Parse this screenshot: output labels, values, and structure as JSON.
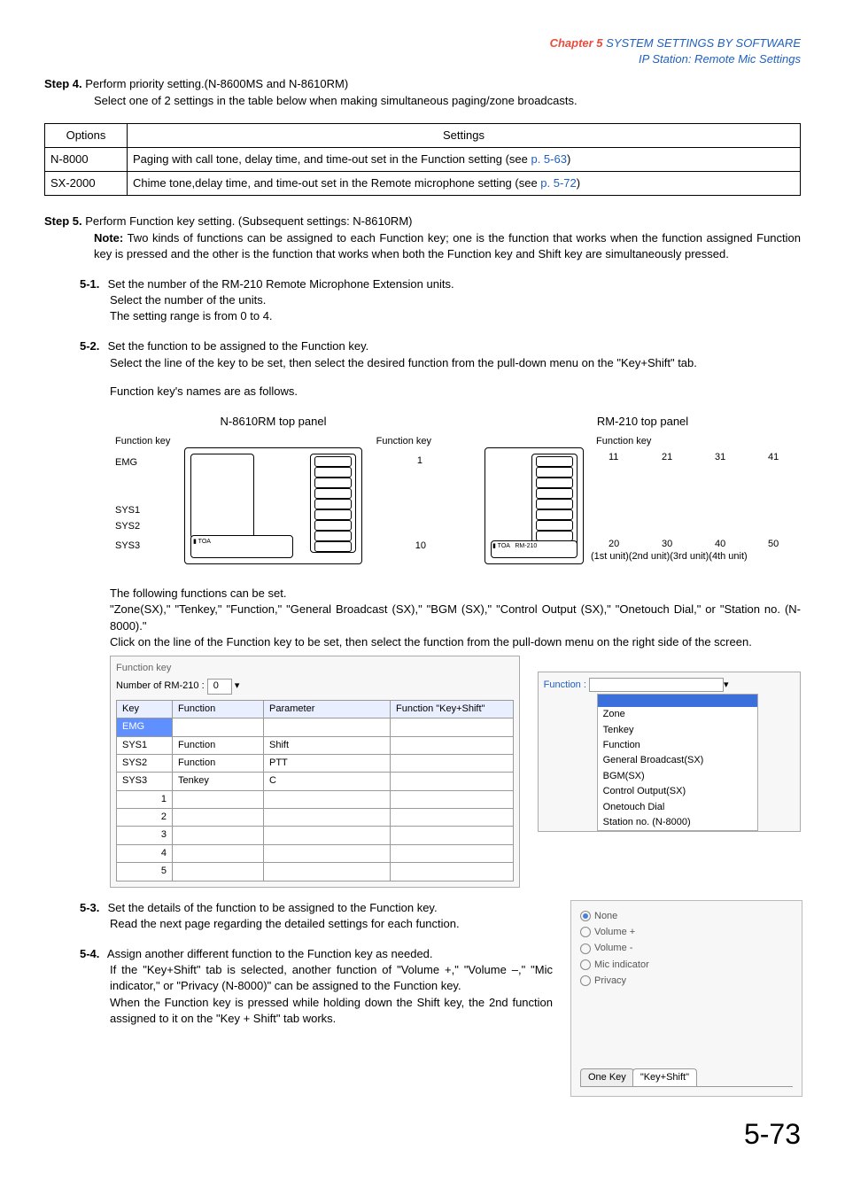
{
  "chapter": {
    "prefix": "Chapter 5",
    "title": "SYSTEM SETTINGS BY SOFTWARE",
    "subtitle": "IP Station: Remote Mic Settings"
  },
  "step4": {
    "label": "Step 4.",
    "title": "Perform priority setting.(N-8600MS and N-8610RM)",
    "desc": "Select one of 2 settings in the table below when making simultaneous paging/zone broadcasts."
  },
  "options_table": {
    "h1": "Options",
    "h2": "Settings",
    "r1c1": "N-8000",
    "r1c2a": "Paging with call tone, delay time, and time-out set in the Function setting (see ",
    "r1c2b": "p. 5-63",
    "r1c2c": ")",
    "r2c1": "SX-2000",
    "r2c2a": "Chime tone,delay time, and time-out set in the Remote microphone setting (see ",
    "r2c2b": "p. 5-72",
    "r2c2c": ")"
  },
  "step5": {
    "label": "Step 5.",
    "title": "Perform Function key setting. (Subsequent settings: N-8610RM)",
    "note_label": "Note:",
    "note_text": "Two kinds of functions can be assigned to each Function key; one is the function that works when the function assigned Function key is pressed and the other is the function that works when both the Function key and Shift key are simultaneously pressed."
  },
  "s51": {
    "label": "5-1.",
    "line1": "Set the number of the RM-210 Remote Microphone Extension units.",
    "line2": "Select the number of the units.",
    "line3": "The setting range is from 0 to 4."
  },
  "s52": {
    "label": "5-2.",
    "line1": "Set the function to be assigned to the Function key.",
    "line2": "Select the line of the key to be set, then select the desired function from the pull-down menu on the \"Key+Shift\" tab.",
    "line3": "Function key's names are as follows."
  },
  "diagrams": {
    "left_title": "N-8610RM top panel",
    "right_title": "RM-210 top panel",
    "fnkey": "Function key",
    "emg": "EMG",
    "sys1": "SYS1",
    "sys2": "SYS2",
    "sys3": "SYS3",
    "n1": "1",
    "n10": "10",
    "n11": "11",
    "n21": "21",
    "n31": "31",
    "n41": "41",
    "n20": "20",
    "n30": "30",
    "n40": "40",
    "n50": "50",
    "units": "(1st unit)(2nd unit)(3rd unit)(4th unit)"
  },
  "after_diag": {
    "line1": "The following functions can be set.",
    "line2": "\"Zone(SX),\" \"Tenkey,\" \"Function,\" \"General Broadcast (SX),\" \"BGM (SX),\" \"Control Output (SX),\" \"Onetouch Dial,\" or \"Station no. (N-8000).\"",
    "line3": "Click on the line of the Function key to be set, then select the function from the pull-down menu on the right side of the screen."
  },
  "fk_panel": {
    "group": "Function key",
    "rm_label": "Number of RM-210 :",
    "rm_val": "0",
    "h_key": "Key",
    "h_fn": "Function",
    "h_param": "Parameter",
    "h_ks": "Function \"Key+Shift\"",
    "rows": {
      "emg": "EMG",
      "sys1": "SYS1",
      "sys1_fn": "Function",
      "sys1_p": "Shift",
      "sys2": "SYS2",
      "sys2_fn": "Function",
      "sys2_p": "PTT",
      "sys3": "SYS3",
      "sys3_fn": "Tenkey",
      "sys3_p": "C",
      "r1": "1",
      "r2": "2",
      "r3": "3",
      "r4": "4",
      "r5": "5"
    },
    "dd_label": "Function :",
    "dd_items": {
      "zone": "Zone",
      "tenkey": "Tenkey",
      "function": "Function",
      "gb": "General Broadcast(SX)",
      "bgm": "BGM(SX)",
      "co": "Control Output(SX)",
      "od": "Onetouch Dial",
      "sn": "Station no. (N-8000)"
    }
  },
  "s53": {
    "label": "5-3.",
    "line1": "Set the details of the function to be assigned to the Function key.",
    "line2": "Read the next page regarding the detailed settings for each function."
  },
  "s54": {
    "label": "5-4.",
    "line1": "Assign another different function to the Function key as needed.",
    "line2": "If the \"Key+Shift\" tab is selected, another function of \"Volume +,\" \"Volume –,\" \"Mic indicator,\" or \"Privacy (N-8000)\" can be assigned to the Function key.",
    "line3": "When the Function key is pressed while holding down the Shift key, the 2nd function assigned to it on the \"Key + Shift\" tab works."
  },
  "radio": {
    "none": "None",
    "vp": "Volume +",
    "vm": "Volume -",
    "mic": "Mic indicator",
    "priv": "Privacy"
  },
  "tabs": {
    "one": "One Key",
    "ks": "\"Key+Shift\""
  },
  "page": "5-73"
}
